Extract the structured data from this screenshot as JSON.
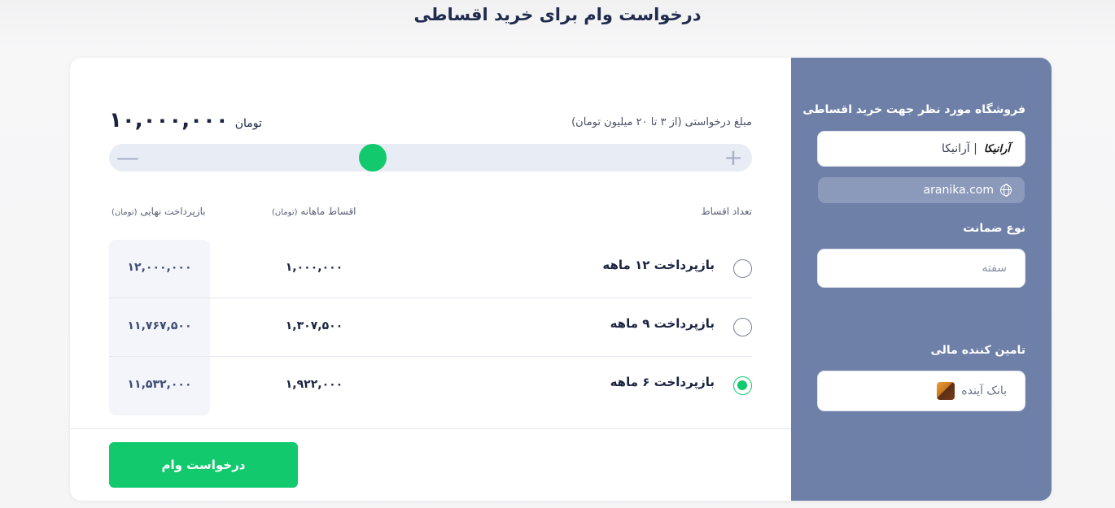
{
  "page": {
    "title": "درخواست وام برای خرید اقساطی"
  },
  "amount": {
    "label": "مبلغ درخواستی (از ۳ تا ۲۰ میلیون تومان)",
    "value": "۱۰,۰۰۰,۰۰۰",
    "unit": "تومان",
    "slider_fraction": 0.41
  },
  "table": {
    "head_count": "تعداد اقساط",
    "head_monthly": "اقساط ماهانه",
    "head_monthly_unit": "(تومان)",
    "head_final": "بازپرداخت نهایی",
    "head_final_unit": "(تومان)",
    "rows": [
      {
        "plan": "بازپرداخت ۱۲ ماهه",
        "monthly": "۱,۰۰۰,۰۰۰",
        "final": "۱۲,۰۰۰,۰۰۰",
        "selected": false
      },
      {
        "plan": "بازپرداخت ۹ ماهه",
        "monthly": "۱,۳۰۷,۵۰۰",
        "final": "۱۱,۷۶۷,۵۰۰",
        "selected": false
      },
      {
        "plan": "بازپرداخت ۶ ماهه",
        "monthly": "۱,۹۲۲,۰۰۰",
        "final": "۱۱,۵۳۲,۰۰۰",
        "selected": true
      }
    ]
  },
  "submit_label": "درخواست وام",
  "sidebar": {
    "store_label": "فروشگاه مورد نظر جهت خرید اقساطی",
    "store_name": "| آرانیکا",
    "store_logo_text": "آرانیکا",
    "store_url": "aranika.com",
    "guarantee_label": "نوع ضمانت",
    "guarantee_value": "سفته",
    "provider_label": "تامین کننده مالی",
    "provider_value": "بانک آینده"
  },
  "colors": {
    "accent": "#12c96e",
    "sidebar": "#6e7fa8",
    "title": "#1f2a4d"
  }
}
